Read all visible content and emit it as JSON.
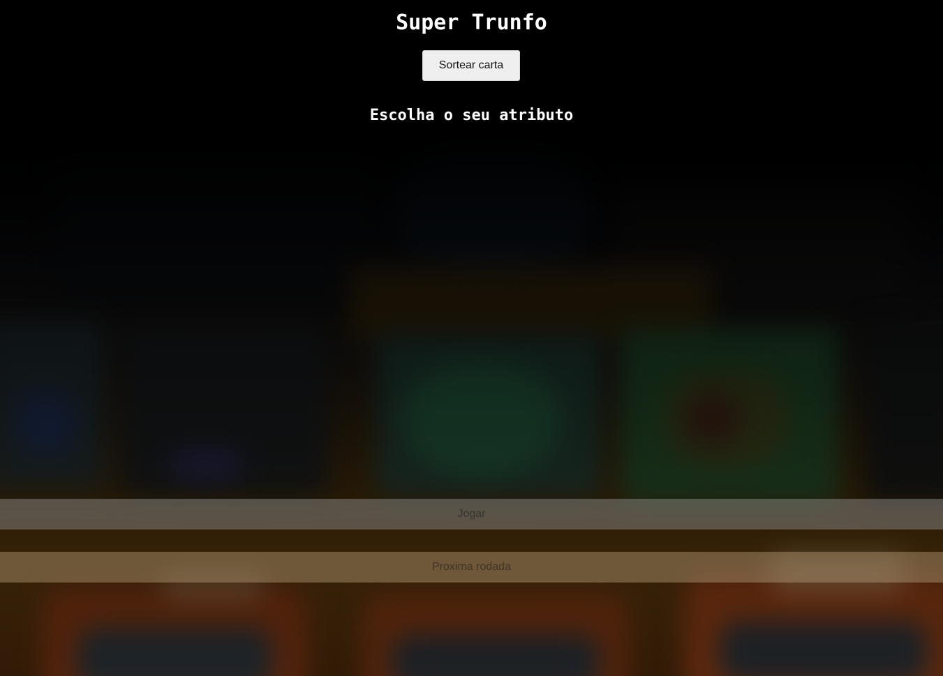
{
  "header": {
    "title": "Super Trunfo"
  },
  "actions": {
    "draw_card_label": "Sortear carta",
    "play_label": "Jogar",
    "next_round_label": "Proxima rodada"
  },
  "attribute_section": {
    "heading": "Escolha o seu atributo"
  },
  "colors": {
    "title_text": "#ffffff",
    "draw_button_bg": "#efefef",
    "play_bar_bg": "#7a7a7a",
    "next_bar_bg": "#8a6f4a"
  }
}
